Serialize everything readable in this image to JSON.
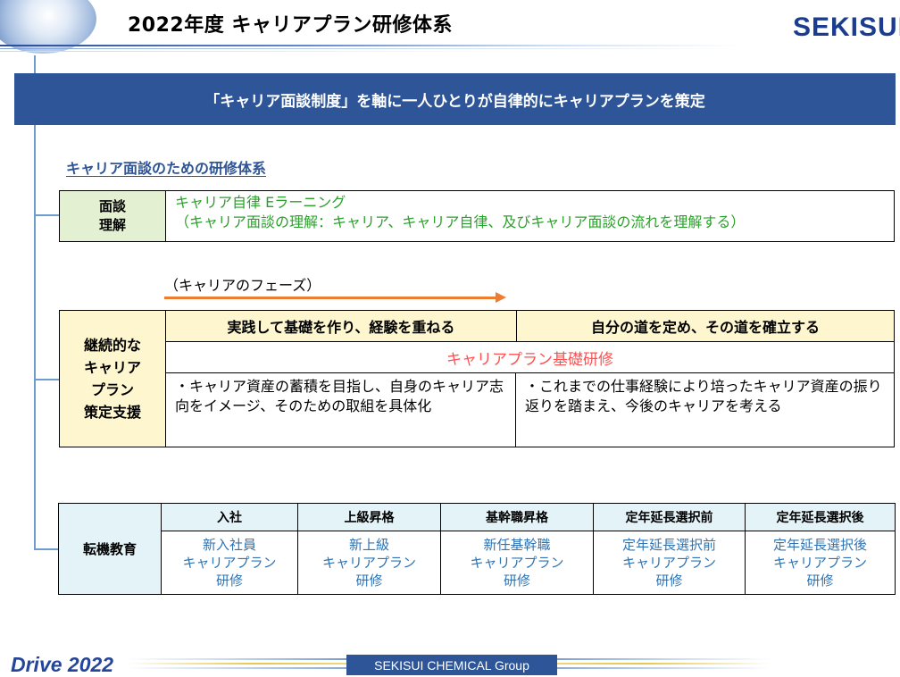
{
  "header": {
    "title": "2022年度 キャリアプラン研修体系",
    "logo_text": "SEKISUI"
  },
  "banner": "「キャリア面談制度」を軸に一人ひとりが自律的にキャリアプランを策定",
  "section_title": "キャリア面談のための研修体系",
  "interview": {
    "label_line1": "面談",
    "label_line2": "理解",
    "text_line1": "キャリア自律 Eラーニング",
    "text_line2": "（キャリア面談の理解：キャリア、キャリア自律、及びキャリア面談の流れを理解する）"
  },
  "phase_label": "（キャリアのフェーズ）",
  "planning": {
    "label_lines": [
      "継続的な",
      "キャリア",
      "プラン",
      "策定支援"
    ],
    "header_left": "実践して基礎を作り、経験を重ねる",
    "header_right": "自分の道を定め、その道を確立する",
    "program": "キャリアプラン基礎研修",
    "desc_left": "・キャリア資産の蓄積を目指し、自身のキャリア志向をイメージ、そのための取組を具体化",
    "desc_right": "・これまでの仕事経験により培ったキャリア資産の振り返りを踏まえ、今後のキャリアを考える"
  },
  "transition": {
    "label": "転機教育",
    "headers": [
      "入社",
      "上級昇格",
      "基幹職昇格",
      "定年延長選択前",
      "定年延長選択後"
    ],
    "cells": [
      [
        "新入社員",
        "キャリアプラン",
        "研修"
      ],
      [
        "新上級",
        "キャリアプラン",
        "研修"
      ],
      [
        "新任基幹職",
        "キャリアプラン",
        "研修"
      ],
      [
        "定年延長選択前",
        "キャリアプラン",
        "研修"
      ],
      [
        "定年延長選択後",
        "キャリアプラン",
        "研修"
      ]
    ]
  },
  "footer": {
    "drive": "Drive 2022",
    "group": "SEKISUI CHEMICAL Group"
  },
  "colors": {
    "banner_bg": "#2e5597",
    "label_green_bg": "#e4f0d2",
    "label_yellow_bg": "#fdf6cf",
    "label_blue_bg": "#e4f3f8",
    "elearning_text": "#2aa12a",
    "program_text": "#ff5050",
    "arrow": "#ed7d31",
    "table_text": "#2e74b5"
  }
}
